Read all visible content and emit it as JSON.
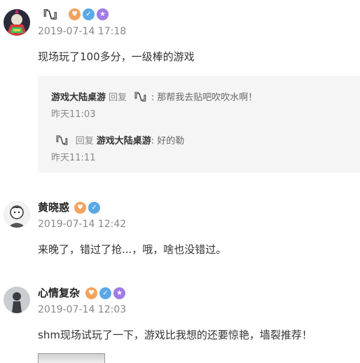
{
  "comments": [
    {
      "name": "『\\』",
      "time": "2019-07-14 17:18",
      "text": "现场玩了100多分，一级棒的游戏",
      "badges": [
        "level-badge",
        "verified-badge",
        "vip-badge"
      ],
      "replies": [
        {
          "from": "游戏大陆桌游",
          "verb": "回复",
          "to": "『\\』",
          "text": ": 那帮我去贴吧吹吹水啊！",
          "time": "昨天11:03"
        },
        {
          "from": "『\\』",
          "verb": "回复",
          "to": "游戏大陆桌游",
          "text": ": 好的勒",
          "time": "昨天11:11"
        }
      ]
    },
    {
      "name": "黄晓惑",
      "time": "2019-07-14 12:42",
      "text": "来晚了，错过了抢...，哦，啥也没错过。",
      "badges": [
        "level-badge",
        "verified-badge"
      ]
    },
    {
      "name": "心情复杂",
      "time": "2019-07-14 12:03",
      "text": "shm现场试玩了一下，游戏比我想的还要惊艳，墙裂推荐！",
      "badges": [
        "level-badge",
        "verified-badge",
        "vip-badge"
      ]
    }
  ],
  "colors": {
    "level": "#f5a25d",
    "verified": "#5aa9e6",
    "vip": "#a07be6"
  }
}
